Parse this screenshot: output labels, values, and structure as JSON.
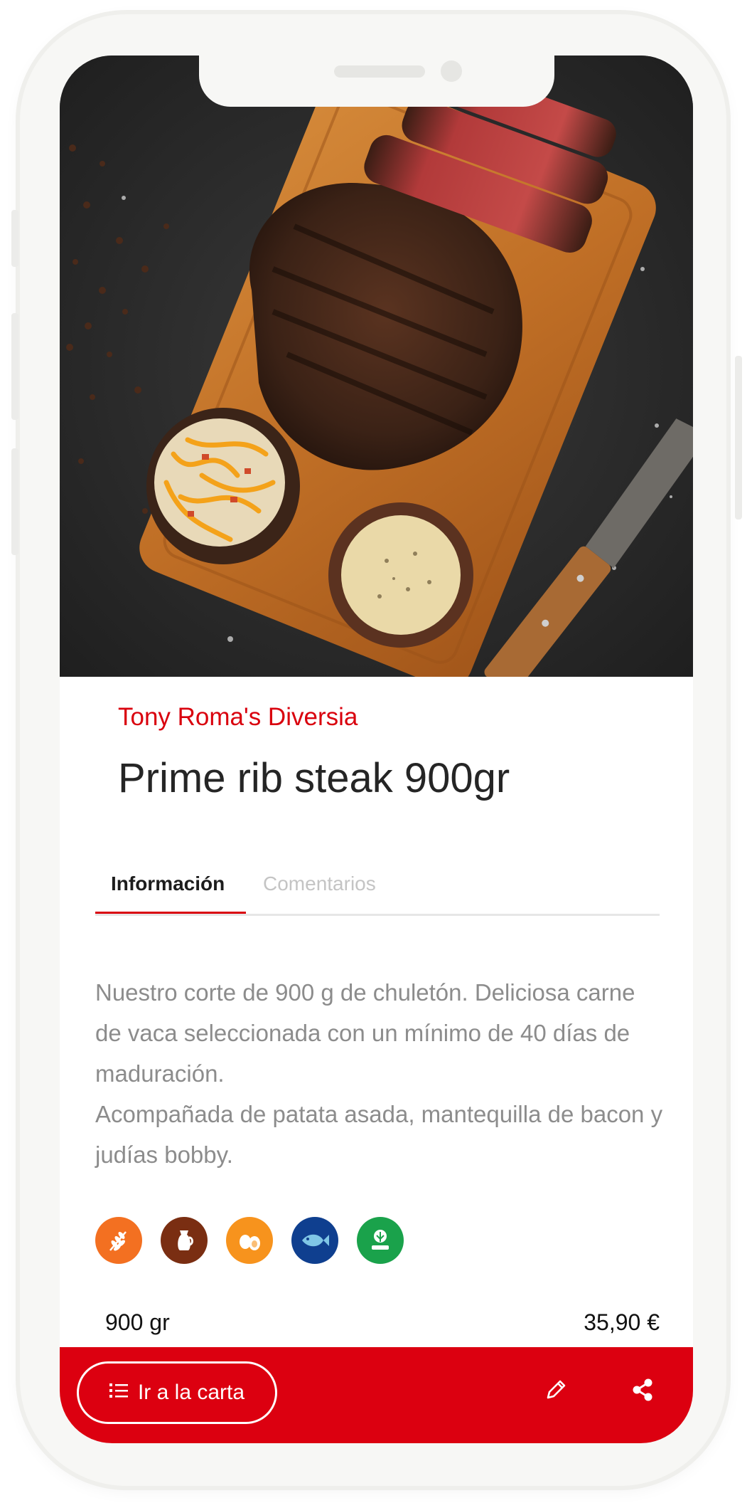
{
  "restaurant": {
    "name": "Tony Roma's Diversia"
  },
  "dish": {
    "title": "Prime rib steak 900gr",
    "description_lines": [
      "Nuestro corte de 900 g de chuletón. Deliciosa carne de vaca seleccionada con un mínimo de 40 días de maduración.",
      "Acompañada de patata asada, mantequilla de bacon y judías bobby."
    ],
    "weight": "900 gr",
    "price": "35,90 €"
  },
  "tabs": [
    {
      "label": "Información",
      "active": true
    },
    {
      "label": "Comentarios",
      "active": false
    }
  ],
  "allergens": [
    {
      "icon": "gluten-wheat-icon",
      "color": "#f37021"
    },
    {
      "icon": "dairy-jug-icon",
      "color": "#7a2e12"
    },
    {
      "icon": "eggs-icon",
      "color": "#f7931d"
    },
    {
      "icon": "fish-icon",
      "color": "#0f3f8f"
    },
    {
      "icon": "celery-icon",
      "color": "#1aa24b"
    }
  ],
  "bottom_bar": {
    "menu_button_label": "Ir a la carta",
    "menu_button_icon": "list-icon",
    "edit_icon": "pencil-icon",
    "share_icon": "share-icon"
  },
  "colors": {
    "accent": "#d9000d",
    "bottom_bar": "#dc0010",
    "title": "#252525",
    "description": "#8c8c8c"
  }
}
